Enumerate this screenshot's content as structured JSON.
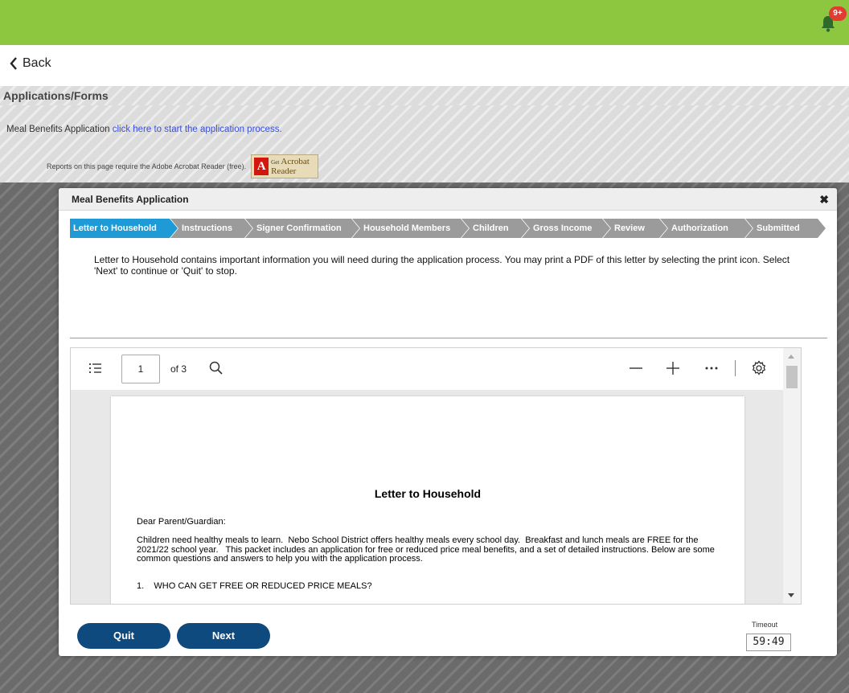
{
  "header": {
    "notification_badge": "9+"
  },
  "nav": {
    "back_label": "Back"
  },
  "section": {
    "title": "Applications/Forms",
    "meal_prefix": "Meal Benefits Application",
    "meal_link": "click here to start the application process.",
    "reports_note": "Reports on this page require the Adobe Acrobat Reader (free).",
    "acrobat_logo_letter": "A",
    "acrobat_get": "Get",
    "acrobat_name": "Acrobat",
    "acrobat_reader": "Reader"
  },
  "modal": {
    "title": "Meal Benefits Application",
    "close_glyph": "✖",
    "steps": [
      {
        "label": "Letter to Household",
        "active": true
      },
      {
        "label": "Instructions",
        "active": false
      },
      {
        "label": "Signer Confirmation",
        "active": false
      },
      {
        "label": "Household Members",
        "active": false
      },
      {
        "label": "Children",
        "active": false
      },
      {
        "label": "Gross Income",
        "active": false
      },
      {
        "label": "Review",
        "active": false
      },
      {
        "label": "Authorization",
        "active": false
      },
      {
        "label": "Submitted",
        "active": false
      }
    ],
    "intro": "Letter to Household contains important information you will need during the application process. You may print a PDF of this letter by selecting the print icon. Select 'Next' to continue or 'Quit' to stop.",
    "pdf_viewer": {
      "current_page": "1",
      "page_total": "of 3",
      "document": {
        "title": "Letter to Household",
        "greeting": "Dear Parent/Guardian:",
        "paragraph": "Children need healthy meals to learn.  Nebo School District offers healthy meals every school day.  Breakfast and lunch meals are FREE for the 2021/22 school year.   This packet includes an application for free or reduced price meal benefits, and a set of detailed instructions. Below are some common questions and answers to help you with the application process.",
        "question_1": "1.    WHO CAN GET FREE OR REDUCED PRICE MEALS?"
      }
    },
    "buttons": {
      "quit": "Quit",
      "next": "Next"
    },
    "timeout": {
      "label": "Timeout",
      "value": "59:49"
    }
  },
  "colors": {
    "topbar": "#8dc63f",
    "active_step": "#1e9ad6",
    "inactive_step": "#9b9b9b",
    "button": "#0e4a7e",
    "badge": "#e03c31"
  },
  "icons": [
    "bell-icon",
    "chevron-left-icon",
    "table-of-contents-icon",
    "search-icon",
    "zoom-out-icon",
    "zoom-in-icon",
    "more-icon",
    "settings-icon",
    "close-icon"
  ]
}
